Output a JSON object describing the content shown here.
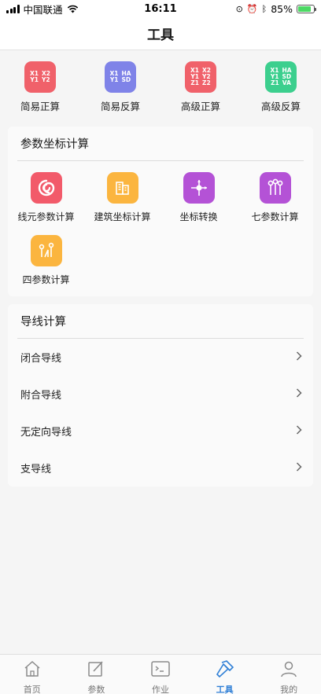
{
  "status_bar": {
    "carrier": "中国联通",
    "time": "16:11",
    "battery_percent": "85%",
    "battery_level": 0.85
  },
  "nav": {
    "title": "工具"
  },
  "quick_tools": [
    {
      "label": "简易正算",
      "icon_lines": [
        "X1",
        "Y1"
      ],
      "icon_lines_b": [
        "X2",
        "Y2"
      ],
      "color": "#f0616a"
    },
    {
      "label": "简易反算",
      "icon_lines": [
        "X1",
        "Y1"
      ],
      "icon_lines_b": [
        "HA",
        "SD"
      ],
      "color": "#7f83e8"
    },
    {
      "label": "高级正算",
      "icon_lines": [
        "X1",
        "Y1",
        "Z1"
      ],
      "icon_lines_b": [
        "X2",
        "Y2",
        "Z2"
      ],
      "color": "#f0616a"
    },
    {
      "label": "高级反算",
      "icon_lines": [
        "X1",
        "Y1",
        "Z1"
      ],
      "icon_lines_b": [
        "HA",
        "SD",
        "VA"
      ],
      "color": "#3ccf8e"
    }
  ],
  "param_section": {
    "title": "参数坐标计算",
    "items": [
      {
        "label": "线元参数计算",
        "icon": "spiral-icon",
        "color": "#f25a6a"
      },
      {
        "label": "建筑坐标计算",
        "icon": "building-icon",
        "color": "#fbb53f"
      },
      {
        "label": "坐标转换",
        "icon": "crosshair-icon",
        "color": "#b452d6"
      },
      {
        "label": "七参数计算",
        "icon": "pins-icon",
        "color": "#b452d6"
      },
      {
        "label": "四参数计算",
        "icon": "pins-small-icon",
        "color": "#fbb53f"
      }
    ]
  },
  "traverse_section": {
    "title": "导线计算",
    "items": [
      {
        "label": "闭合导线"
      },
      {
        "label": "附合导线"
      },
      {
        "label": "无定向导线"
      },
      {
        "label": "支导线"
      }
    ]
  },
  "tabs": [
    {
      "label": "首页",
      "icon": "home-icon",
      "active": false
    },
    {
      "label": "参数",
      "icon": "edit-icon",
      "active": false
    },
    {
      "label": "作业",
      "icon": "terminal-icon",
      "active": false
    },
    {
      "label": "工具",
      "icon": "hammer-icon",
      "active": true
    },
    {
      "label": "我的",
      "icon": "user-icon",
      "active": false
    }
  ],
  "colors": {
    "accent": "#2f7fd6",
    "background": "#f5f5f5"
  }
}
